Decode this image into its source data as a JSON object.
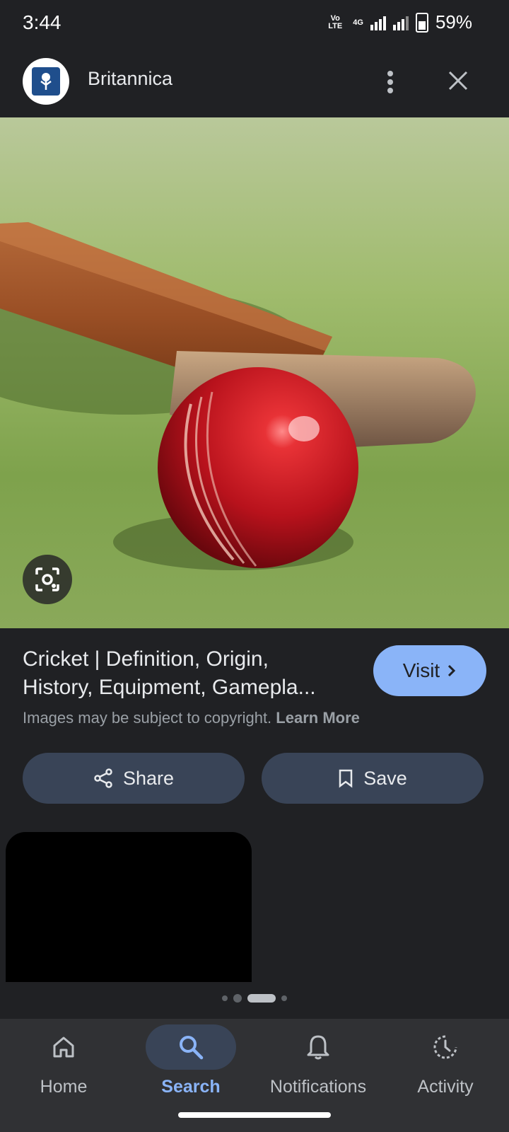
{
  "status": {
    "time": "3:44",
    "network": "4G",
    "volte_line1": "Vo LTE",
    "volte_line2": "LTE2",
    "battery": "59%"
  },
  "header": {
    "site_name": "Britannica",
    "logo_icon": "britannica-thistle-icon",
    "more_icon": "more-vert-icon",
    "close_icon": "close-icon"
  },
  "image": {
    "subject": "cricket bat and red ball on grass",
    "lens_icon": "google-lens-icon"
  },
  "result": {
    "title_line1": "Cricket | Definition, Origin,",
    "title_line2": "History, Equipment, Gamepla...",
    "visit_label": "Visit",
    "copyright_text": "Images may be subject to copyright.",
    "learn_more": "Learn More"
  },
  "actions": {
    "share_label": "Share",
    "save_label": "Save"
  },
  "pagination": {
    "dots": 4,
    "active_index": 2
  },
  "bottom_nav": {
    "items": [
      {
        "label": "Home",
        "icon": "home-icon"
      },
      {
        "label": "Search",
        "icon": "search-icon",
        "active": true
      },
      {
        "label": "Notifications",
        "icon": "bell-icon"
      },
      {
        "label": "Activity",
        "icon": "activity-history-icon"
      }
    ]
  },
  "colors": {
    "background": "#202124",
    "accent": "#8ab4f8",
    "button_bg": "#394457",
    "nav_bg": "#303134"
  }
}
